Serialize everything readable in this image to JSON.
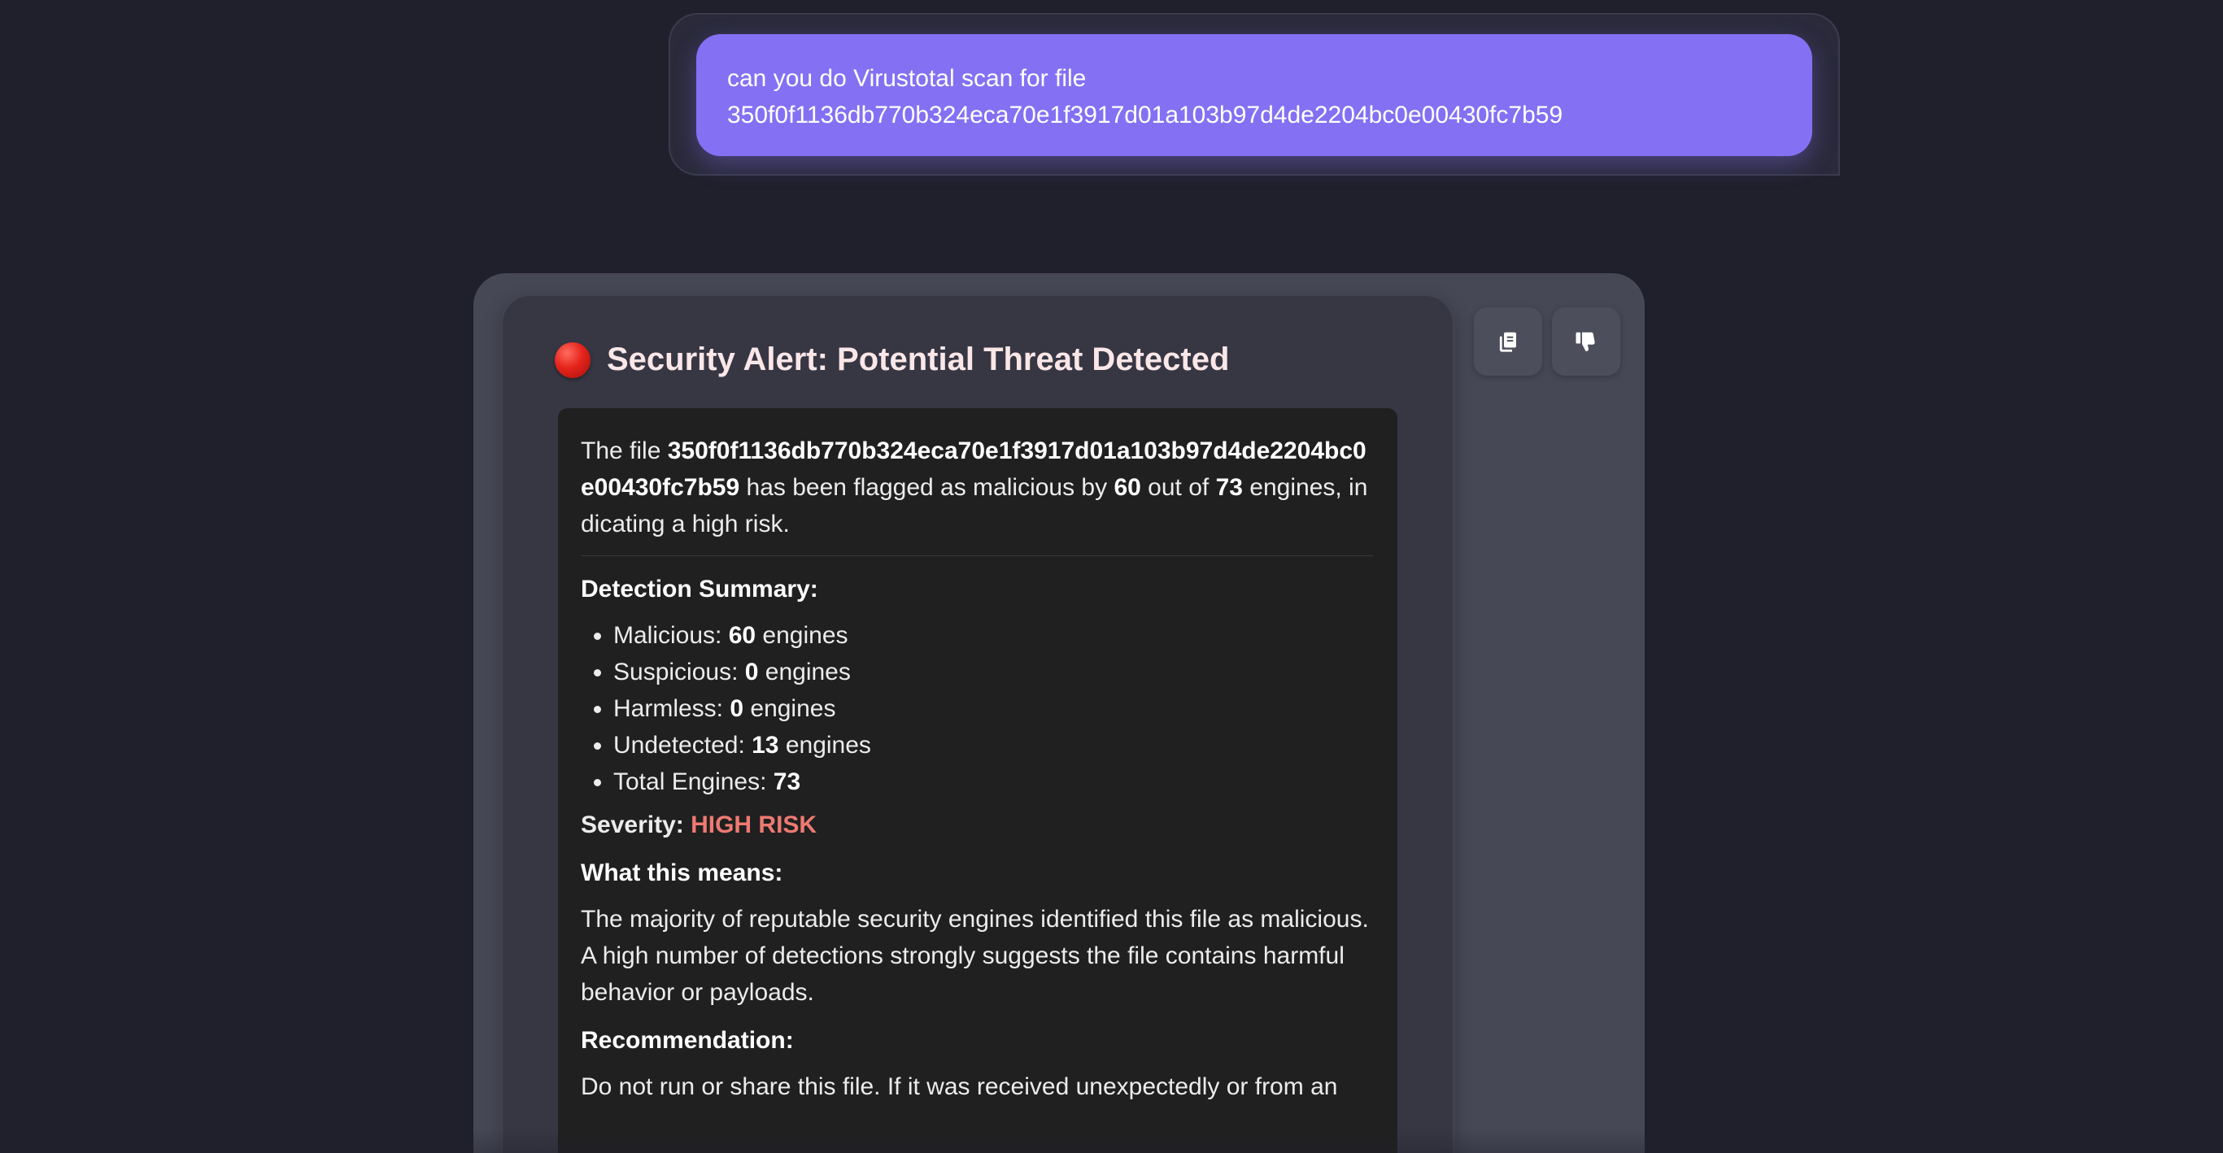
{
  "user_message": {
    "line1": "can you do Virustotal scan for file",
    "line2": "350f0f1136db770b324eca70e1f3917d01a103b97d4de2204bc0e00430fc7b59"
  },
  "assistant": {
    "icons": {
      "status": "red-circle-icon",
      "copy": "copy-icon",
      "dislike": "thumbs-down-icon"
    },
    "title": "Security Alert: Potential Threat Detected",
    "intro": {
      "prefix": "The file ",
      "file_hash": "350f0f1136db770b324eca70e1f3917d01a103b97d4de2204bc0e00430fc7b59",
      "mid1": " has been flagged as malicious by ",
      "malicious": "60",
      "mid2": " out of ",
      "total": "73",
      "suffix": " engines, indicating a high risk."
    },
    "detection_summary": {
      "heading": "Detection Summary:",
      "items": [
        {
          "label": "Malicious: ",
          "value": "60",
          "unit": " engines"
        },
        {
          "label": "Suspicious: ",
          "value": "0",
          "unit": " engines"
        },
        {
          "label": "Harmless: ",
          "value": "0",
          "unit": " engines"
        },
        {
          "label": "Undetected: ",
          "value": "13",
          "unit": " engines"
        },
        {
          "label": "Total Engines: ",
          "value": "73",
          "unit": ""
        }
      ]
    },
    "severity": {
      "label": "Severity: ",
      "value": "HIGH RISK"
    },
    "what_this_means": {
      "heading": "What this means:",
      "text": "The majority of reputable security engines identified this file as malicious. A high number of detections strongly suggests the file contains harmful behavior or payloads."
    },
    "recommendation": {
      "heading": "Recommendation:",
      "text": "Do not run or share this file. If it was received unexpectedly or from an"
    }
  },
  "colors": {
    "background": "#20202c",
    "user_bubble": "#8470f3",
    "risk": "#ee7a72"
  }
}
